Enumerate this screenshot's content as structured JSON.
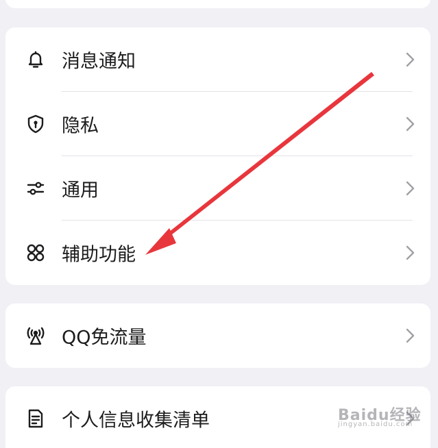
{
  "settings_group_1": {
    "items": [
      {
        "label": "消息通知",
        "icon": "bell-icon"
      },
      {
        "label": "隐私",
        "icon": "shield-lock-icon"
      },
      {
        "label": "通用",
        "icon": "sliders-icon"
      },
      {
        "label": "辅助功能",
        "icon": "grid-apps-icon"
      }
    ]
  },
  "settings_group_2": {
    "items": [
      {
        "label": "QQ免流量",
        "icon": "signal-tower-icon"
      }
    ]
  },
  "settings_group_3": {
    "items": [
      {
        "label": "个人信息收集清单",
        "icon": "document-icon"
      }
    ]
  },
  "annotation": {
    "arrow_color": "#e8363d",
    "points_to": "辅助功能"
  },
  "watermark": {
    "brand": "Baidu经验",
    "sub": "jingyan.baidu.com"
  },
  "colors": {
    "background": "#f1f0f5",
    "card": "#ffffff",
    "text": "#1c1c1e",
    "chevron": "#a0a0a6"
  }
}
